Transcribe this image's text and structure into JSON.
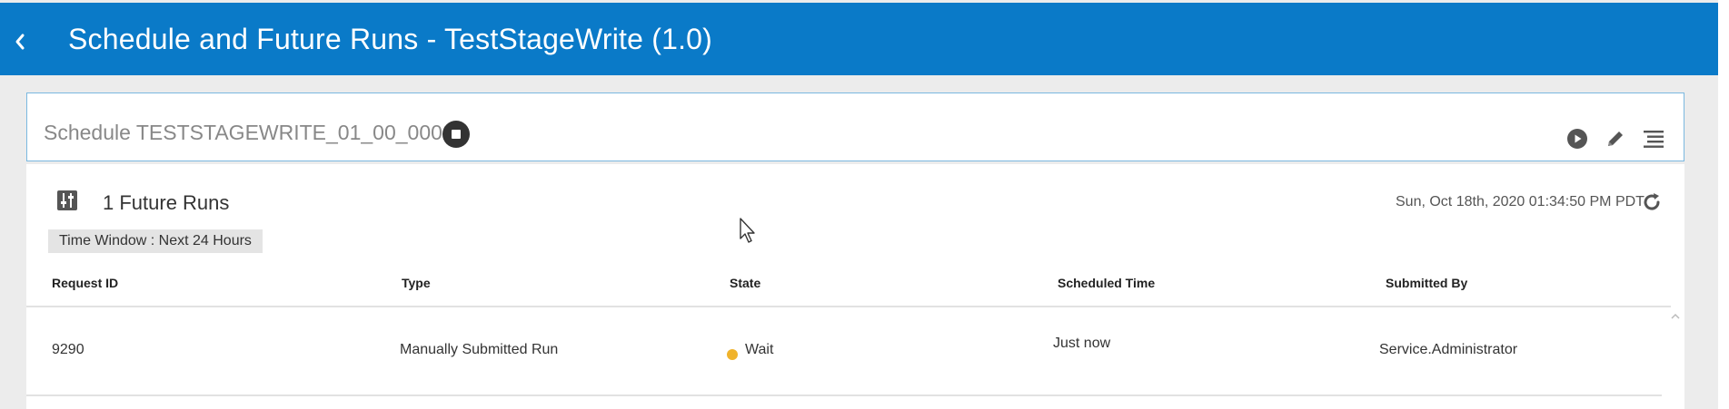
{
  "header": {
    "title": "Schedule and Future Runs - TestStageWrite (1.0)",
    "back_icon": "chevron-left-icon",
    "background": "#0a7ac8"
  },
  "schedule": {
    "title": "Schedule TESTSTAGEWRITE_01_00_0000",
    "stop_icon": "stop-circle-icon",
    "actions": [
      "play-circle-icon",
      "pencil-icon",
      "list-icon"
    ]
  },
  "future_runs": {
    "icon": "sliders-icon",
    "title": "1 Future Runs",
    "timestamp": "Sun, Oct 18th, 2020 01:34:50 PM PDT",
    "refresh_icon": "refresh-icon",
    "time_window": "Time Window : Next 24 Hours",
    "columns": [
      "Request ID",
      "Type",
      "State",
      "Scheduled Time",
      "Submitted By"
    ],
    "rows": [
      {
        "request_id": "9290",
        "type": "Manually Submitted Run",
        "state": "Wait",
        "state_color": "#f0b32c",
        "scheduled_time": "Just now",
        "submitted_by": "Service.Administrator"
      }
    ]
  }
}
